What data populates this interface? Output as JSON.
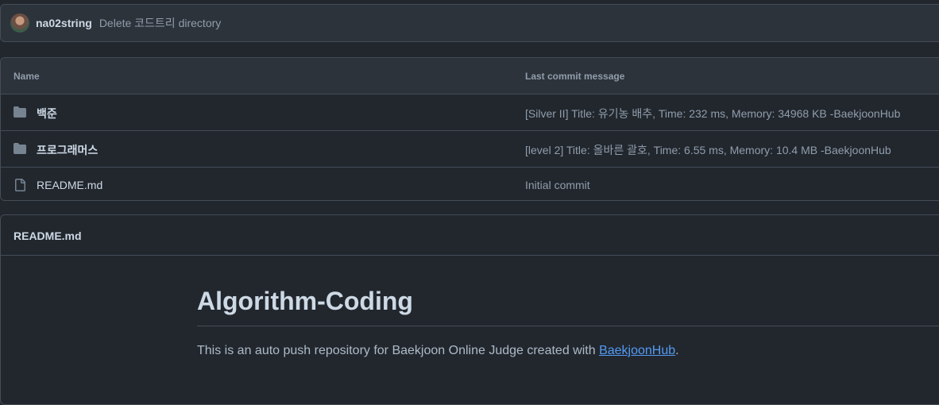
{
  "commit": {
    "author": "na02string",
    "message": "Delete 코드트리 directory"
  },
  "file_table": {
    "col_name": "Name",
    "col_message": "Last commit message",
    "rows": [
      {
        "name": "백준",
        "type": "folder",
        "message": "[Silver II] Title: 유기농 배추, Time: 232 ms, Memory: 34968 KB -BaekjoonHub"
      },
      {
        "name": "프로그래머스",
        "type": "folder",
        "message": "[level 2] Title: 올바른 괄호, Time: 6.55 ms, Memory: 10.4 MB -BaekjoonHub"
      },
      {
        "name": "README.md",
        "type": "file",
        "message": "Initial commit"
      }
    ]
  },
  "readme": {
    "filename": "README.md",
    "heading": "Algorithm-Coding",
    "text_before": "This is an auto push repository for Baekjoon Online Judge created with ",
    "link_text": "BaekjoonHub",
    "text_after": "."
  },
  "colors": {
    "background": "#22272e",
    "header_bg": "#2d333b",
    "border": "#444c56",
    "link": "#539bf5"
  }
}
